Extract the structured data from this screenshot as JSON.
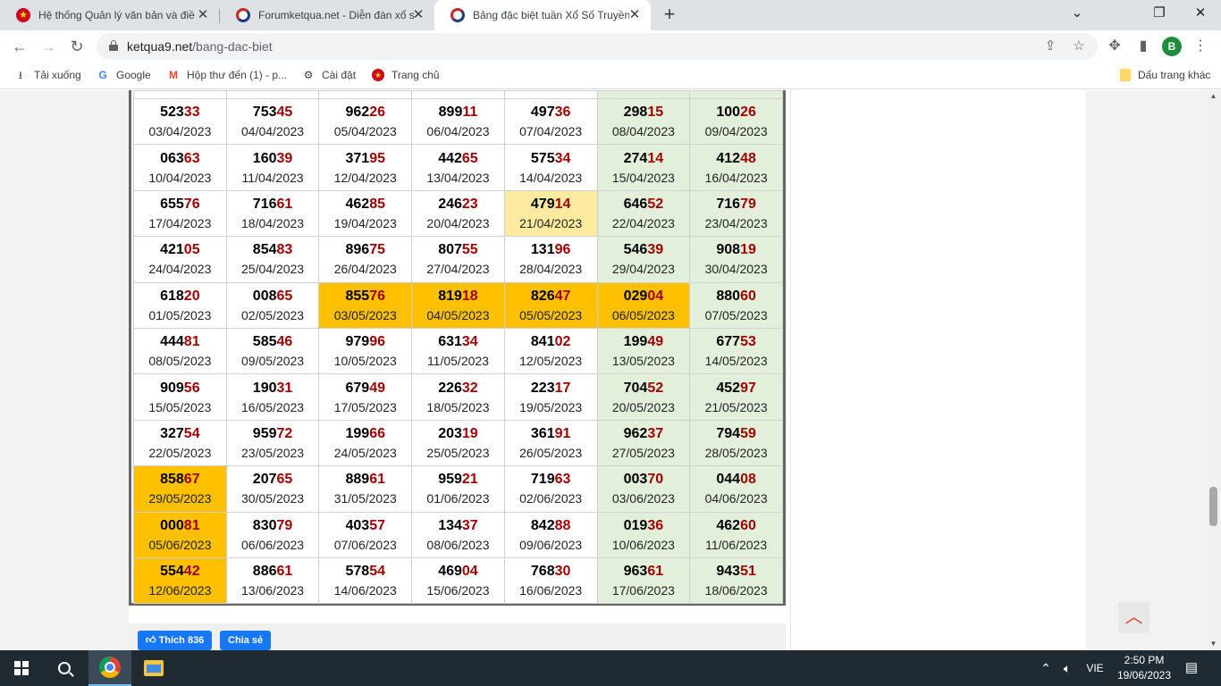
{
  "browser": {
    "tabs": [
      {
        "title": "Hệ thống Quản lý văn bản và điều hành",
        "active": false
      },
      {
        "title": "Forumketqua.net - Diễn đàn xổ số",
        "active": false
      },
      {
        "title": "Bảng đặc biệt tuần Xổ Số Truyền thống",
        "active": true
      }
    ],
    "new_tab": "+",
    "window": {
      "minimize": "⌄",
      "restore": "❐",
      "close": "✕"
    },
    "url": {
      "host": "ketqua9.net",
      "path": "/bang-dac-biet"
    },
    "nav": {
      "back": "←",
      "forward": "→",
      "reload": "↻"
    },
    "profile_initial": "B"
  },
  "bookmarks": [
    {
      "label": "Tải xuống",
      "icon": "download-icon",
      "glyph": "⭳"
    },
    {
      "label": "Google",
      "icon": "google-icon",
      "glyph": "G"
    },
    {
      "label": "Hộp thư đến (1) - p...",
      "icon": "gmail-icon",
      "glyph": "M"
    },
    {
      "label": "Cài đặt",
      "icon": "gear-icon",
      "glyph": "⚙"
    },
    {
      "label": "Trang chủ",
      "icon": "emblem-icon",
      "glyph": "★"
    }
  ],
  "bookmarks_other": "Dấu trang khác",
  "special_table": {
    "rows": [
      [
        {
          "num": "52333",
          "date": "03/04/2023"
        },
        {
          "num": "75345",
          "date": "04/04/2023"
        },
        {
          "num": "96226",
          "date": "05/04/2023"
        },
        {
          "num": "89911",
          "date": "06/04/2023"
        },
        {
          "num": "49736",
          "date": "07/04/2023"
        },
        {
          "num": "29815",
          "date": "08/04/2023"
        },
        {
          "num": "10026",
          "date": "09/04/2023"
        }
      ],
      [
        {
          "num": "06363",
          "date": "10/04/2023"
        },
        {
          "num": "16039",
          "date": "11/04/2023"
        },
        {
          "num": "37195",
          "date": "12/04/2023"
        },
        {
          "num": "44265",
          "date": "13/04/2023"
        },
        {
          "num": "57534",
          "date": "14/04/2023"
        },
        {
          "num": "27414",
          "date": "15/04/2023"
        },
        {
          "num": "41248",
          "date": "16/04/2023"
        }
      ],
      [
        {
          "num": "65576",
          "date": "17/04/2023"
        },
        {
          "num": "71661",
          "date": "18/04/2023"
        },
        {
          "num": "46285",
          "date": "19/04/2023"
        },
        {
          "num": "24623",
          "date": "20/04/2023"
        },
        {
          "num": "47914",
          "date": "21/04/2023",
          "hl": "light"
        },
        {
          "num": "64652",
          "date": "22/04/2023"
        },
        {
          "num": "71679",
          "date": "23/04/2023"
        }
      ],
      [
        {
          "num": "42105",
          "date": "24/04/2023"
        },
        {
          "num": "85483",
          "date": "25/04/2023"
        },
        {
          "num": "89675",
          "date": "26/04/2023"
        },
        {
          "num": "80755",
          "date": "27/04/2023"
        },
        {
          "num": "13196",
          "date": "28/04/2023"
        },
        {
          "num": "54639",
          "date": "29/04/2023"
        },
        {
          "num": "90819",
          "date": "30/04/2023"
        }
      ],
      [
        {
          "num": "61820",
          "date": "01/05/2023"
        },
        {
          "num": "00865",
          "date": "02/05/2023"
        },
        {
          "num": "85576",
          "date": "03/05/2023",
          "hl": "gold"
        },
        {
          "num": "81918",
          "date": "04/05/2023",
          "hl": "gold"
        },
        {
          "num": "82647",
          "date": "05/05/2023",
          "hl": "gold"
        },
        {
          "num": "02904",
          "date": "06/05/2023",
          "hl": "gold"
        },
        {
          "num": "88060",
          "date": "07/05/2023"
        }
      ],
      [
        {
          "num": "44481",
          "date": "08/05/2023"
        },
        {
          "num": "58546",
          "date": "09/05/2023"
        },
        {
          "num": "97996",
          "date": "10/05/2023"
        },
        {
          "num": "63134",
          "date": "11/05/2023"
        },
        {
          "num": "84102",
          "date": "12/05/2023"
        },
        {
          "num": "19949",
          "date": "13/05/2023"
        },
        {
          "num": "67753",
          "date": "14/05/2023"
        }
      ],
      [
        {
          "num": "90956",
          "date": "15/05/2023"
        },
        {
          "num": "19031",
          "date": "16/05/2023"
        },
        {
          "num": "67949",
          "date": "17/05/2023"
        },
        {
          "num": "22632",
          "date": "18/05/2023"
        },
        {
          "num": "22317",
          "date": "19/05/2023"
        },
        {
          "num": "70452",
          "date": "20/05/2023"
        },
        {
          "num": "45297",
          "date": "21/05/2023"
        }
      ],
      [
        {
          "num": "32754",
          "date": "22/05/2023"
        },
        {
          "num": "95972",
          "date": "23/05/2023"
        },
        {
          "num": "19966",
          "date": "24/05/2023"
        },
        {
          "num": "20319",
          "date": "25/05/2023"
        },
        {
          "num": "36191",
          "date": "26/05/2023"
        },
        {
          "num": "96237",
          "date": "27/05/2023"
        },
        {
          "num": "79459",
          "date": "28/05/2023"
        }
      ],
      [
        {
          "num": "85867",
          "date": "29/05/2023",
          "hl": "gold"
        },
        {
          "num": "20765",
          "date": "30/05/2023"
        },
        {
          "num": "88961",
          "date": "31/05/2023"
        },
        {
          "num": "95921",
          "date": "01/06/2023"
        },
        {
          "num": "71963",
          "date": "02/06/2023"
        },
        {
          "num": "00370",
          "date": "03/06/2023"
        },
        {
          "num": "04408",
          "date": "04/06/2023"
        }
      ],
      [
        {
          "num": "00081",
          "date": "05/06/2023",
          "hl": "gold"
        },
        {
          "num": "83079",
          "date": "06/06/2023"
        },
        {
          "num": "40357",
          "date": "07/06/2023"
        },
        {
          "num": "13437",
          "date": "08/06/2023"
        },
        {
          "num": "84288",
          "date": "09/06/2023"
        },
        {
          "num": "01936",
          "date": "10/06/2023"
        },
        {
          "num": "46260",
          "date": "11/06/2023"
        }
      ],
      [
        {
          "num": "55442",
          "date": "12/06/2023",
          "hl": "gold"
        },
        {
          "num": "88661",
          "date": "13/06/2023"
        },
        {
          "num": "57854",
          "date": "14/06/2023"
        },
        {
          "num": "46904",
          "date": "15/06/2023"
        },
        {
          "num": "76830",
          "date": "16/06/2023"
        },
        {
          "num": "96361",
          "date": "17/06/2023"
        },
        {
          "num": "94351",
          "date": "18/06/2023"
        }
      ]
    ]
  },
  "social": {
    "like_label": "Thích 836",
    "share_label": "Chia sẻ"
  },
  "scroll_to_top": "^",
  "taskbar": {
    "tray_language": "VIE",
    "time": "2:50 PM",
    "date": "19/06/2023"
  },
  "colors": {
    "weekend_bg": "#e2efda",
    "highlight_gold": "#ffc000",
    "highlight_light": "#ffeba0",
    "last_two_digits": "#a00000"
  }
}
